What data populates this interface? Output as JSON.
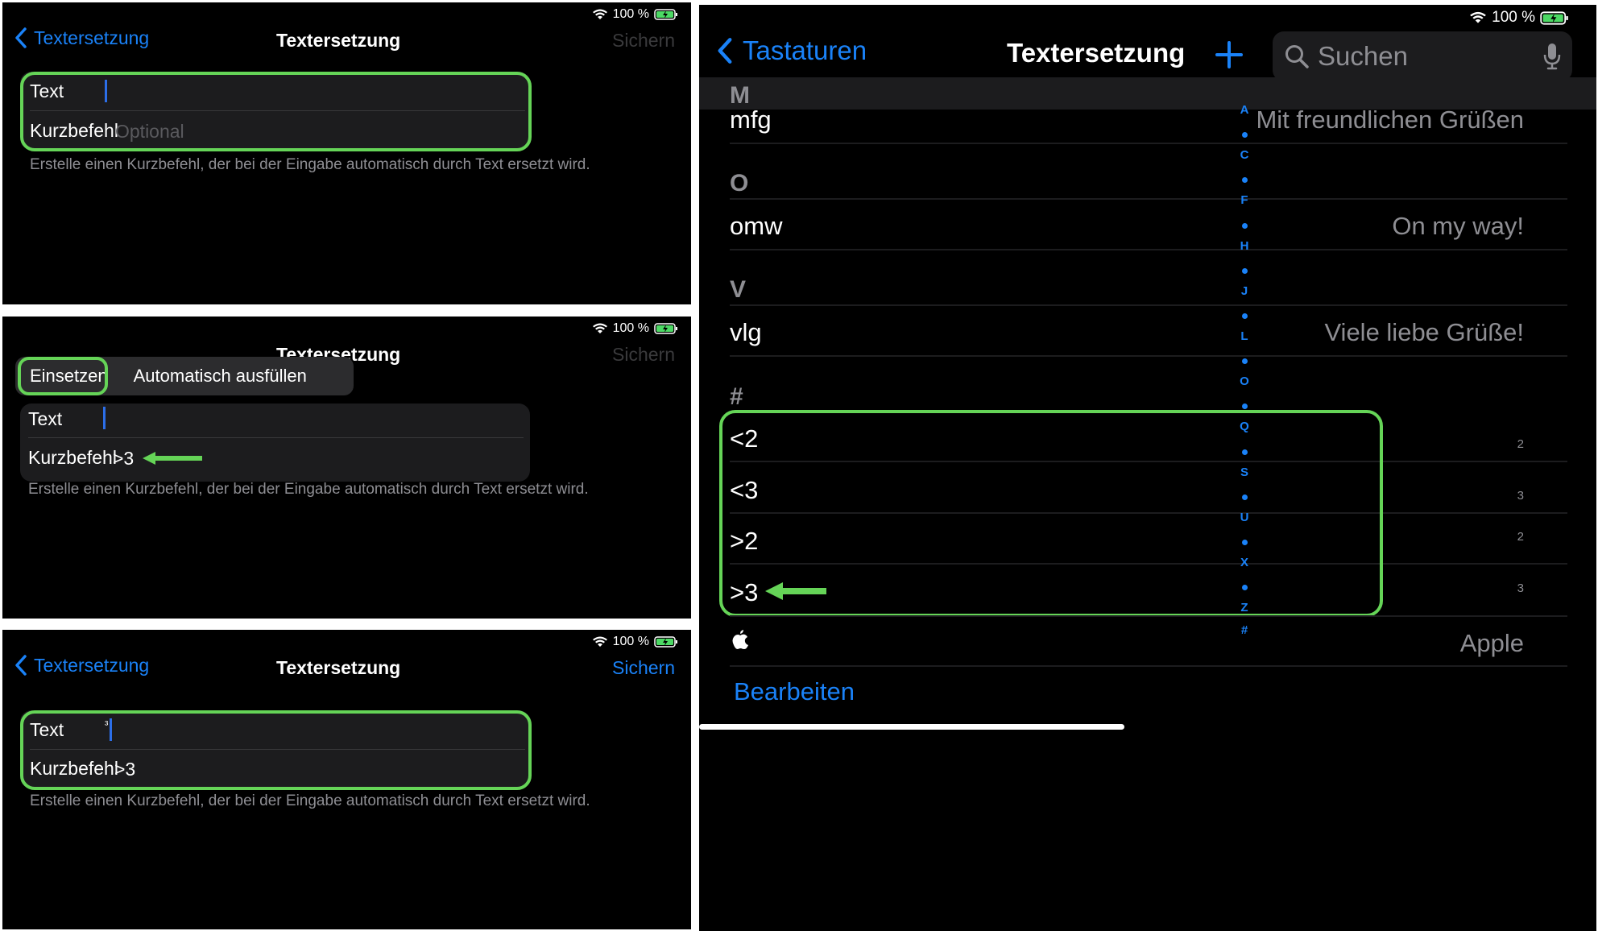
{
  "status": {
    "battery": "100 %"
  },
  "panel1": {
    "back": "Textersetzung",
    "title": "Textersetzung",
    "save": "Sichern",
    "text_label": "Text",
    "shortcut_label": "Kurzbefehl",
    "shortcut_placeholder": "Optional",
    "footer": "Erstelle einen Kurzbefehl, der bei der Eingabe automatisch durch Text ersetzt wird."
  },
  "panel2": {
    "title_partial": "Textersetzung",
    "save": "Sichern",
    "menu": {
      "paste": "Einsetzen",
      "autofill": "Automatisch ausfüllen"
    },
    "text_label": "Text",
    "shortcut_label": "Kurzbefehl",
    "shortcut_value": ">3",
    "footer": "Erstelle einen Kurzbefehl, der bei der Eingabe automatisch durch Text ersetzt wird."
  },
  "panel3": {
    "back": "Textersetzung",
    "title": "Textersetzung",
    "save": "Sichern",
    "text_label": "Text",
    "text_value": "³",
    "shortcut_label": "Kurzbefehl",
    "shortcut_value": ">3",
    "footer": "Erstelle einen Kurzbefehl, der bei der Eingabe automatisch durch Text ersetzt wird."
  },
  "panel4": {
    "back": "Tastaturen",
    "title": "Textersetzung",
    "search_placeholder": "Suchen",
    "sections": [
      {
        "header": "M",
        "items": [
          {
            "shortcut": "mfg",
            "phrase": "Mit freundlichen Grüßen"
          }
        ]
      },
      {
        "header": "O",
        "items": [
          {
            "shortcut": "omw",
            "phrase": "On my way!"
          }
        ]
      },
      {
        "header": "V",
        "items": [
          {
            "shortcut": "vlg",
            "phrase": "Viele liebe Grüße!"
          }
        ]
      },
      {
        "header": "#",
        "items": [
          {
            "shortcut": "<2",
            "phrase": "2"
          },
          {
            "shortcut": "<3",
            "phrase": "3"
          },
          {
            "shortcut": ">2",
            "phrase": "2"
          },
          {
            "shortcut": ">3",
            "phrase": "3"
          }
        ]
      }
    ],
    "apple_row_phrase": "Apple",
    "edit": "Bearbeiten",
    "index": [
      "A",
      "•",
      "C",
      "•",
      "F",
      "•",
      "H",
      "•",
      "J",
      "•",
      "L",
      "•",
      "O",
      "•",
      "Q",
      "•",
      "S",
      "•",
      "U",
      "•",
      "X",
      "•",
      "Z",
      "#"
    ]
  },
  "colors": {
    "accent": "#1a82f8",
    "highlight": "#65d457",
    "background": "#000000",
    "caret": "#2c6ee8"
  },
  "icons": [
    "wifi-icon",
    "battery-charging-icon",
    "chevron-left-icon",
    "plus-icon",
    "search-icon",
    "microphone-icon",
    "apple-logo-icon",
    "green-arrow-icon"
  ]
}
